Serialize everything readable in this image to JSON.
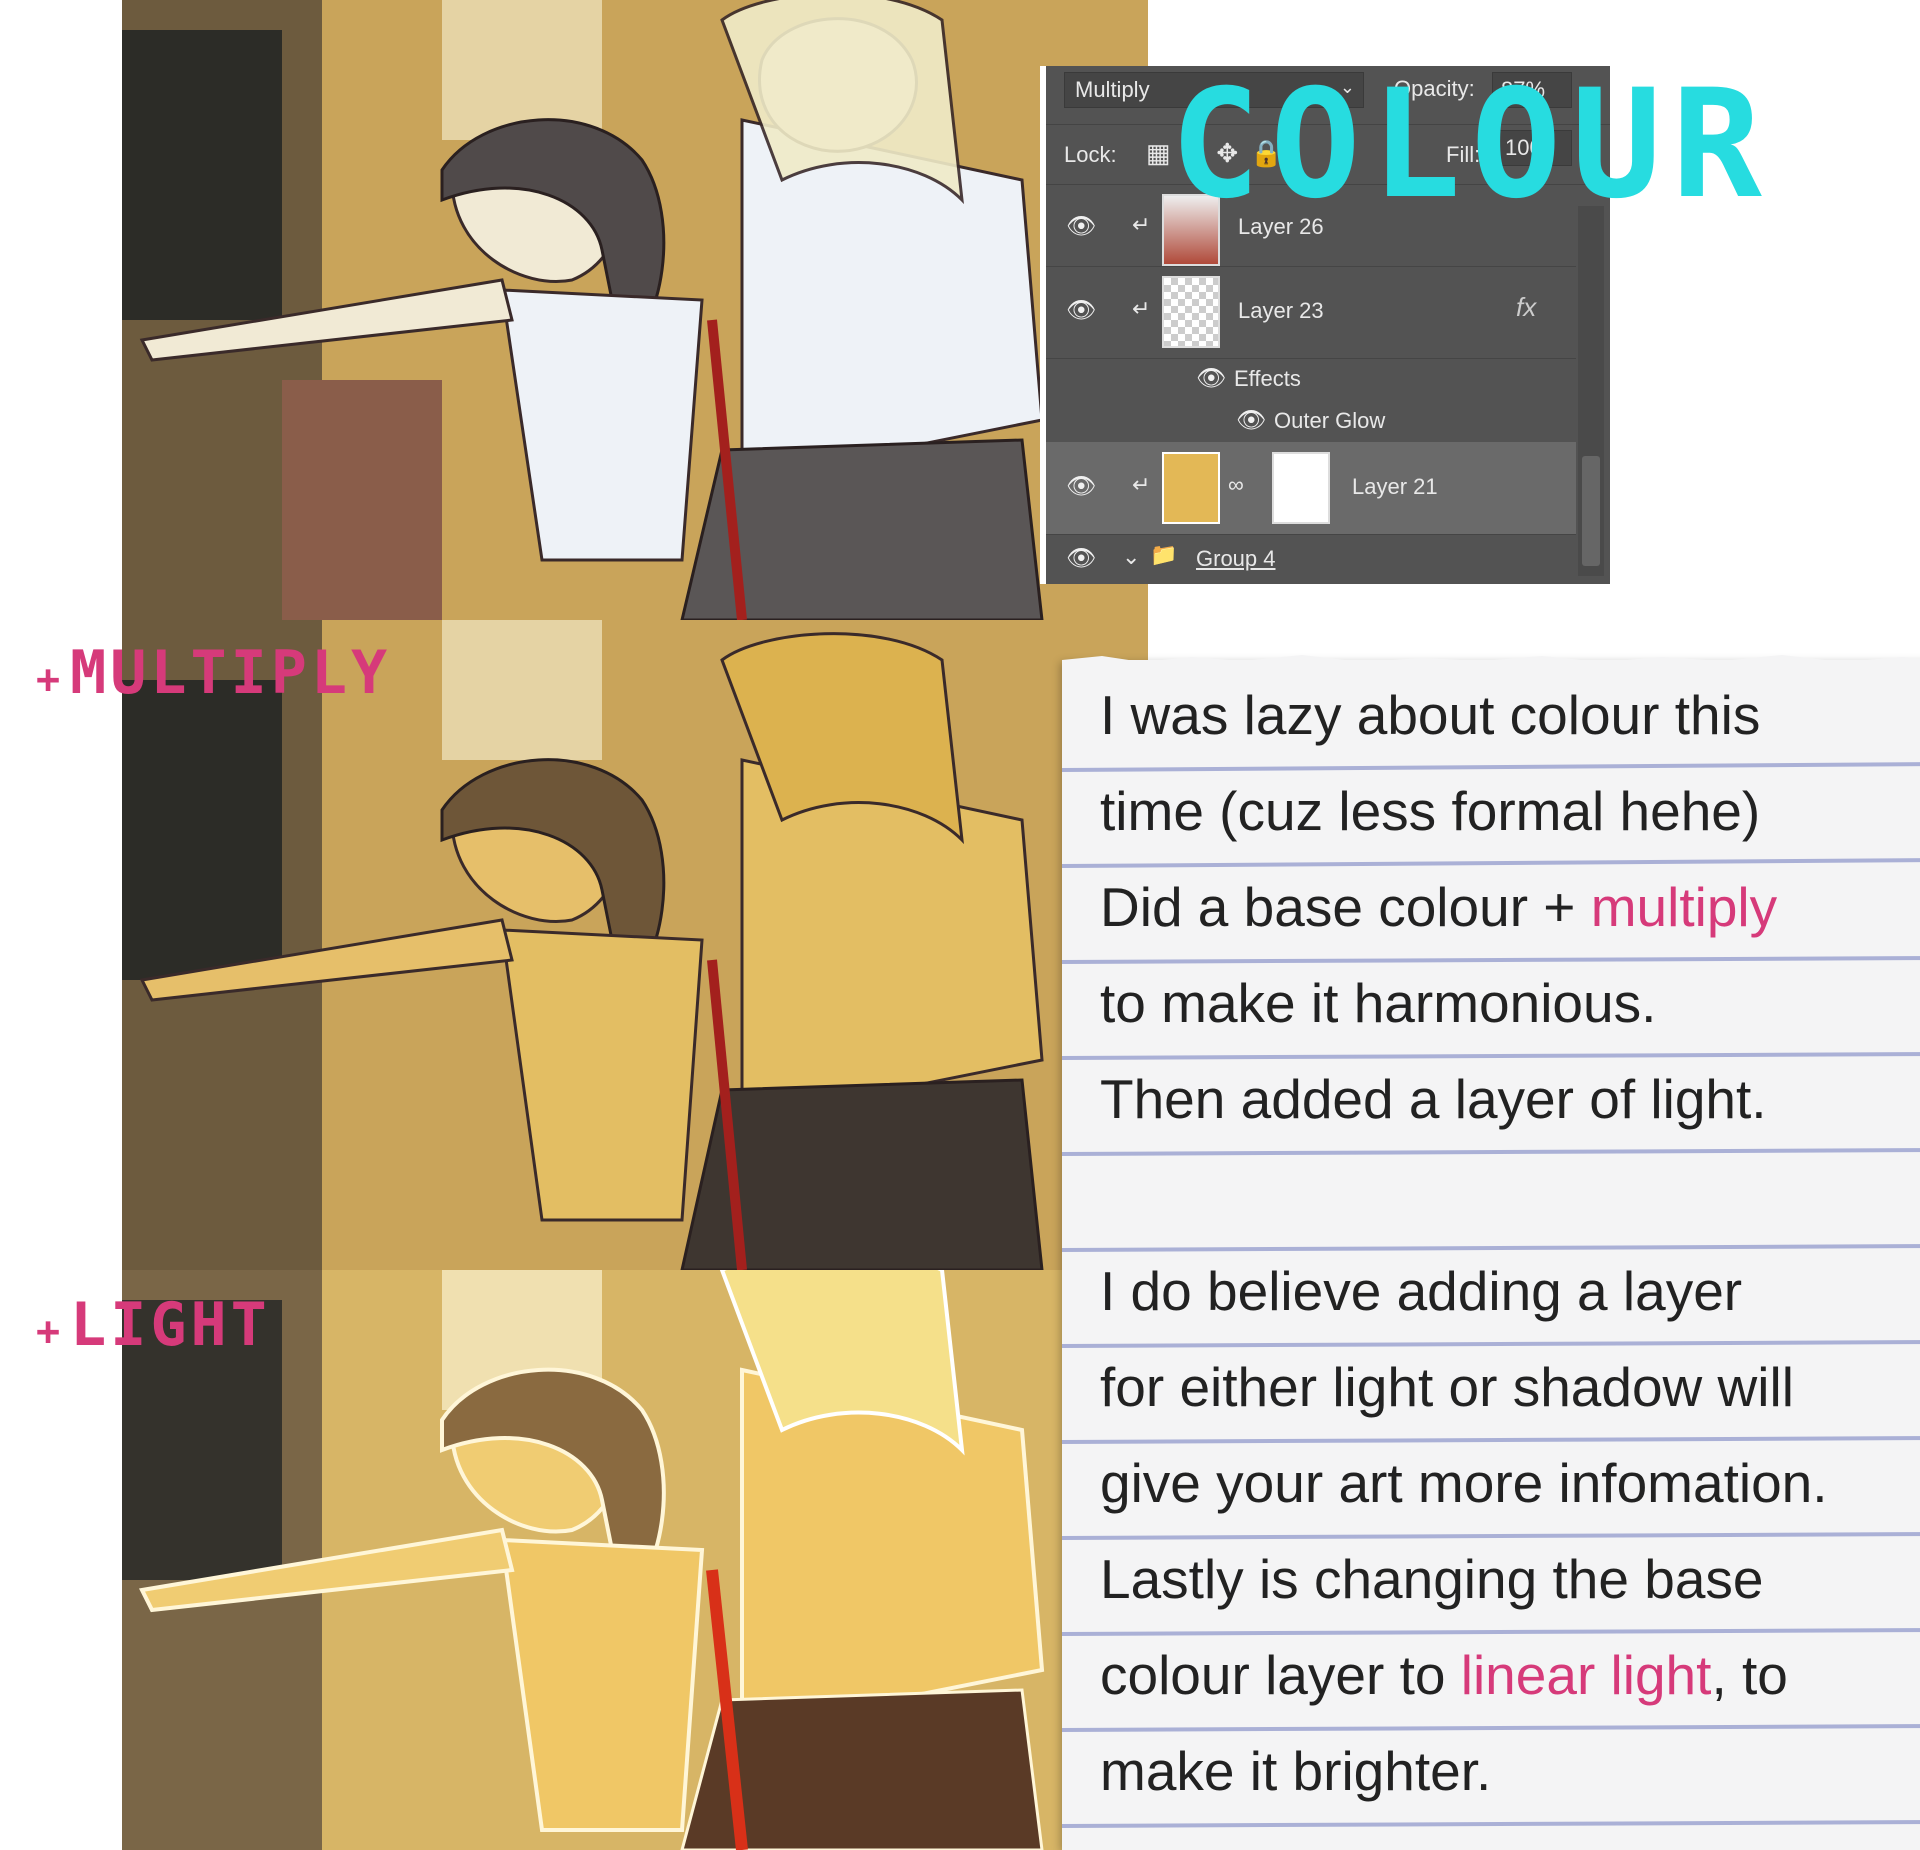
{
  "title": "COLOUR",
  "steps": {
    "multiply": {
      "plus": "+",
      "label": "MULTIPLY"
    },
    "light": {
      "plus": "+",
      "label": "LIGHT"
    }
  },
  "layers_panel": {
    "blend_mode": "Multiply",
    "opacity_label": "Opacity:",
    "opacity_value": "87%",
    "lock_label": "Lock:",
    "fill_label": "Fill:",
    "fill_value": "100",
    "layers": [
      {
        "name": "Layer 26",
        "has_fx": false
      },
      {
        "name": "Layer 23",
        "has_fx": true,
        "fx": "fx"
      },
      {
        "name": "Effects"
      },
      {
        "name": "Outer Glow"
      },
      {
        "name": "Layer 21",
        "selected": true
      },
      {
        "name": "Group 4"
      }
    ]
  },
  "notes": {
    "l1": "I was lazy about colour this",
    "l2": "time (cuz less formal hehe)",
    "l3_pre": "Did a base colour + ",
    "l3_hl": "multiply",
    "l4": "to make it harmonious.",
    "l5": "Then added a layer of light.",
    "l6": "I do believe adding a layer",
    "l7": "for either light or shadow will",
    "l8": "give your art more infomation.",
    "l9": "Lastly is changing the base",
    "l10_pre": "colour layer to ",
    "l10_hl": "linear light",
    "l10_post": ", to",
    "l11": "make it brighter."
  },
  "colors": {
    "accent_pink": "#d63a7a",
    "title_cyan": "#27dce0",
    "panel_bg": "#535353",
    "skin_base": "#e3be63"
  }
}
